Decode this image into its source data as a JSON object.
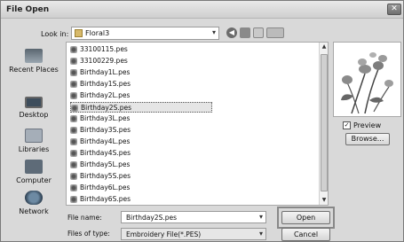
{
  "window": {
    "title": "File Open",
    "close_glyph": "✕"
  },
  "lookin": {
    "label": "Look in:",
    "value": "Floral3"
  },
  "toolbar": {
    "back_glyph": "◀"
  },
  "places": [
    {
      "label": "Recent Places",
      "icon": "recent-places-icon"
    },
    {
      "label": "Desktop",
      "icon": "desktop-icon"
    },
    {
      "label": "Libraries",
      "icon": "libraries-icon"
    },
    {
      "label": "Computer",
      "icon": "computer-icon"
    },
    {
      "label": "Network",
      "icon": "network-icon"
    }
  ],
  "files": [
    "33100115.pes",
    "33100229.pes",
    "Birthday1L.pes",
    "Birthday1S.pes",
    "Birthday2L.pes",
    "Birthday2S.pes",
    "Birthday3L.pes",
    "Birthday3S.pes",
    "Birthday4L.pes",
    "Birthday4S.pes",
    "Birthday5L.pes",
    "Birthday5S.pes",
    "Birthday6L.pes",
    "Birthday6S.pes"
  ],
  "selected_file_index": 5,
  "filename": {
    "label": "File name:",
    "value": "Birthday2S.pes"
  },
  "filetype": {
    "label": "Files of type:",
    "value": "Embroidery File(*.PES)"
  },
  "buttons": {
    "open": "Open",
    "cancel": "Cancel",
    "browse": "Browse..."
  },
  "preview": {
    "label": "Preview",
    "checked": true,
    "check_glyph": "✓"
  },
  "scroll_glyphs": {
    "up": "▲",
    "down": "▼"
  },
  "combo_arrow": "▾"
}
